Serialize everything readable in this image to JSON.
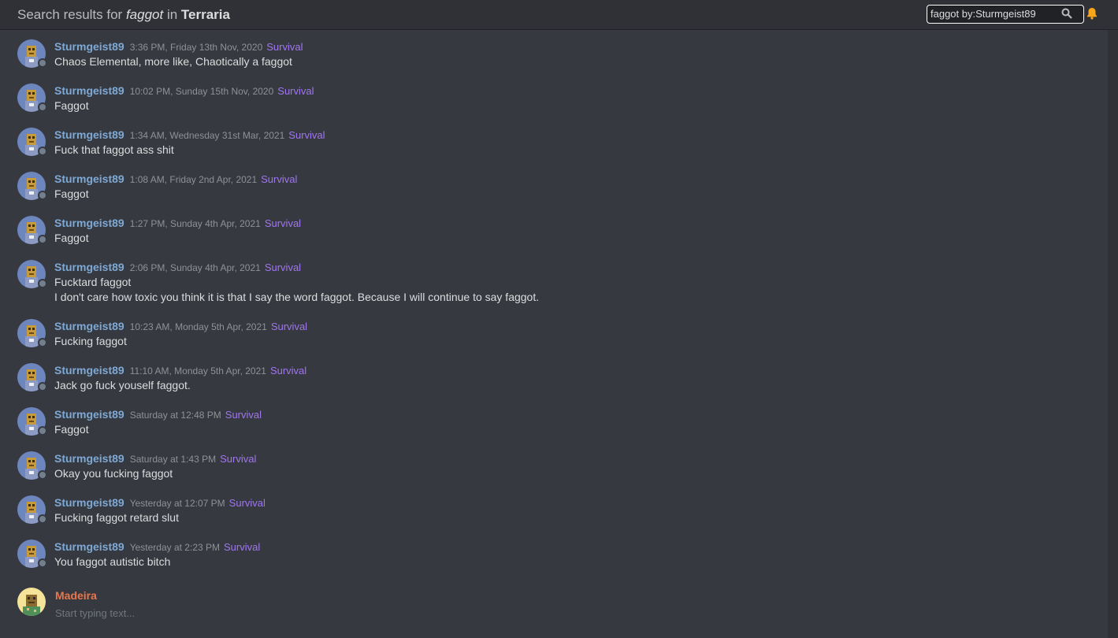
{
  "header": {
    "prefix": "Search results for ",
    "query": "faggot",
    "in_word": " in ",
    "server": "Terraria"
  },
  "search": {
    "value": "faggot by:Sturmgeist89",
    "icon": "search-icon"
  },
  "notifications": {
    "icon": "bell-icon",
    "color": "#faa61a"
  },
  "colors": {
    "username": "#7ea9d6",
    "tag": "#a076f0",
    "compose_name": "#e8774e"
  },
  "messages": [
    {
      "user": "Sturmgeist89",
      "time": "3:36 PM, Friday 13th Nov, 2020",
      "tag": "Survival",
      "lines": [
        "Chaos Elemental, more like, Chaotically a faggot"
      ]
    },
    {
      "user": "Sturmgeist89",
      "time": "10:02 PM, Sunday 15th Nov, 2020",
      "tag": "Survival",
      "lines": [
        "Faggot"
      ]
    },
    {
      "user": "Sturmgeist89",
      "time": "1:34 AM, Wednesday 31st Mar, 2021",
      "tag": "Survival",
      "lines": [
        "Fuck that faggot ass shit"
      ]
    },
    {
      "user": "Sturmgeist89",
      "time": "1:08 AM, Friday 2nd Apr, 2021",
      "tag": "Survival",
      "lines": [
        "Faggot"
      ]
    },
    {
      "user": "Sturmgeist89",
      "time": "1:27 PM, Sunday 4th Apr, 2021",
      "tag": "Survival",
      "lines": [
        "Faggot"
      ]
    },
    {
      "user": "Sturmgeist89",
      "time": "2:06 PM, Sunday 4th Apr, 2021",
      "tag": "Survival",
      "lines": [
        "Fucktard faggot",
        "I don't care how toxic you think it is that I say the word faggot. Because I will continue to say faggot."
      ]
    },
    {
      "user": "Sturmgeist89",
      "time": "10:23 AM, Monday 5th Apr, 2021",
      "tag": "Survival",
      "lines": [
        "Fucking faggot"
      ]
    },
    {
      "user": "Sturmgeist89",
      "time": "11:10 AM, Monday 5th Apr, 2021",
      "tag": "Survival",
      "lines": [
        "Jack go fuck youself faggot."
      ]
    },
    {
      "user": "Sturmgeist89",
      "time": "Saturday at 12:48 PM",
      "tag": "Survival",
      "lines": [
        "Faggot"
      ]
    },
    {
      "user": "Sturmgeist89",
      "time": "Saturday at 1:43 PM",
      "tag": "Survival",
      "lines": [
        "Okay you fucking faggot"
      ]
    },
    {
      "user": "Sturmgeist89",
      "time": "Yesterday at 12:07 PM",
      "tag": "Survival",
      "lines": [
        "Fucking faggot retard slut"
      ]
    },
    {
      "user": "Sturmgeist89",
      "time": "Yesterday at 2:23 PM",
      "tag": "Survival",
      "lines": [
        "You faggot autistic bitch"
      ]
    }
  ],
  "compose": {
    "user": "Madeira",
    "placeholder": "Start typing text..."
  }
}
